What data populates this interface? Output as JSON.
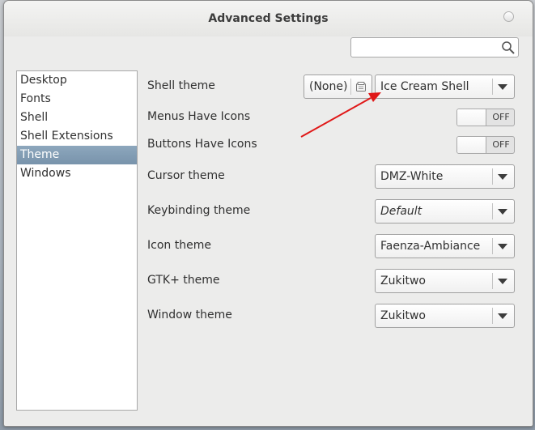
{
  "window": {
    "title": "Advanced Settings"
  },
  "search": {
    "value": "",
    "placeholder": ""
  },
  "sidebar": {
    "items": [
      {
        "label": "Desktop"
      },
      {
        "label": "Fonts"
      },
      {
        "label": "Shell"
      },
      {
        "label": "Shell Extensions"
      },
      {
        "label": "Theme",
        "selected": true
      },
      {
        "label": "Windows"
      }
    ]
  },
  "settings": {
    "shell_theme": {
      "label": "Shell theme",
      "none_button": "(None)",
      "value": "Ice Cream Shell"
    },
    "menus_have_icons": {
      "label": "Menus Have Icons",
      "state": "OFF"
    },
    "buttons_have_icons": {
      "label": "Buttons Have Icons",
      "state": "OFF"
    },
    "cursor_theme": {
      "label": "Cursor theme",
      "value": "DMZ-White"
    },
    "keybinding_theme": {
      "label": "Keybinding theme",
      "value": "Default"
    },
    "icon_theme": {
      "label": "Icon theme",
      "value": "Faenza-Ambiance"
    },
    "gtk_theme": {
      "label": "GTK+ theme",
      "value": "Zukitwo"
    },
    "window_theme": {
      "label": "Window theme",
      "value": "Zukitwo"
    }
  },
  "colors": {
    "selection": "#7f9ab1",
    "annotation_arrow": "#e01818"
  }
}
